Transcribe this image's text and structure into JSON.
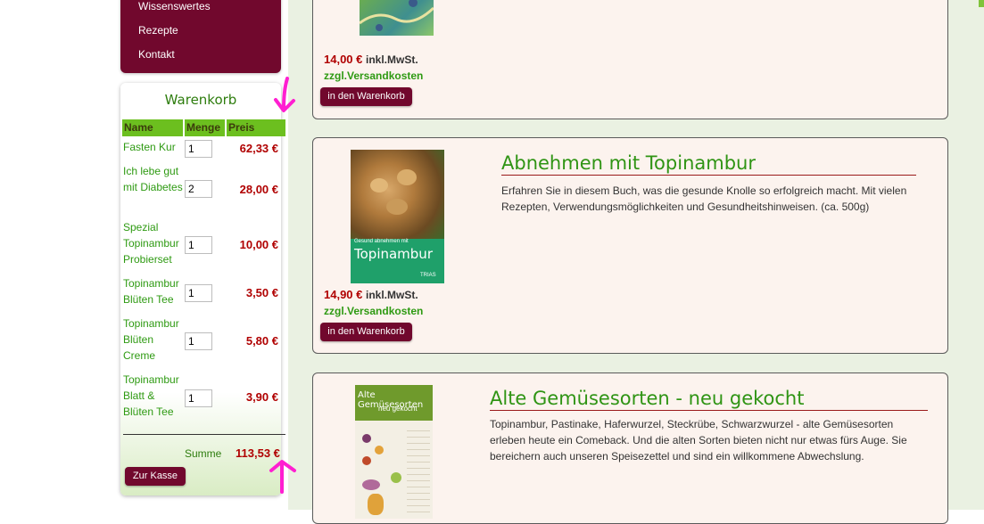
{
  "nav": {
    "items": [
      {
        "label": "Wissenswertes"
      },
      {
        "label": "Rezepte"
      },
      {
        "label": "Kontakt"
      }
    ]
  },
  "cart": {
    "title": "Warenkorb",
    "headers": {
      "name": "Name",
      "qty": "Menge",
      "price": "Preis"
    },
    "items": [
      {
        "name": "Fasten Kur",
        "qty": "1",
        "price": "62,33 €"
      },
      {
        "name": "Ich lebe gut mit Diabetes",
        "qty": "2",
        "price": "28,00 €"
      },
      {
        "name": "Spezial Topinambur Probierset",
        "qty": "1",
        "price": "10,00 €"
      },
      {
        "name": "Topinambur Blüten Tee",
        "qty": "1",
        "price": "3,50 €"
      },
      {
        "name": "Topinambur Blüten Creme",
        "qty": "1",
        "price": "5,80 €"
      },
      {
        "name": "Topinambur Blatt & Blüten Tee",
        "qty": "1",
        "price": "3,90 €"
      }
    ],
    "sum_label": "Summe",
    "sum_value": "113,53 €",
    "checkout_label": "Zur Kasse"
  },
  "products": [
    {
      "price": "14,00 €",
      "mwst": "inkl.MwSt.",
      "shipping": "zzgl.Versandkosten",
      "button": "in den Warenkorb"
    },
    {
      "title": "Abnehmen mit Topinambur",
      "description": "Erfahren Sie in diesem Buch, was die gesunde Knolle so erfolgreich macht. Mit vielen Rezepten, Verwendungsmöglichkeiten und Gesundheitshinweisen. (ca. 500g)",
      "price": "14,90 €",
      "mwst": "inkl.MwSt.",
      "shipping": "zzgl.Versandkosten",
      "button": "in den Warenkorb",
      "cover": {
        "subtitle": "Gesund abnehmen mit",
        "title": "Topinambur",
        "publisher": "TRIAS"
      }
    },
    {
      "title": "Alte Gemüsesorten - neu gekocht",
      "description": "Topinambur, Pastinake, Haferwurzel, Steckrübe, Schwarzwurzel - alte Gemüsesorten erleben heute ein Comeback. Und die alten Sorten bieten nicht nur etwas fürs Auge. Sie bereichern auch unseren Speisezettel und sind ein willkommene Abwechslung.",
      "cover": {
        "title": "Alte Gemüsesorten",
        "subtitle": "neu gekocht"
      }
    }
  ],
  "colors": {
    "nav_bg": "#71082d",
    "green_text": "#2e9a12",
    "price_red": "#b00000",
    "header_green": "#6cbf1f",
    "product_bg": "#fcf3ee",
    "annotation_pink": "#ff1fd1"
  },
  "annotations": {
    "arrow_down": "arrow-down-icon",
    "arrow_up": "arrow-up-icon"
  }
}
